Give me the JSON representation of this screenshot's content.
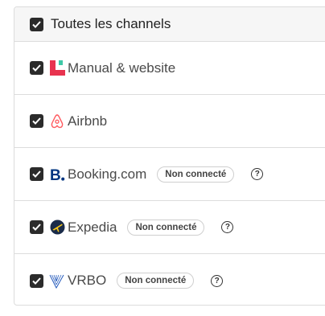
{
  "header": {
    "label": "Toutes les channels",
    "checked": true
  },
  "channels": [
    {
      "name": "Manual & website",
      "logo": "manual-website-logo-icon",
      "checked": true
    },
    {
      "name": "Airbnb",
      "logo": "airbnb-logo-icon",
      "checked": true
    },
    {
      "name": "Booking.com",
      "logo": "booking-logo-icon",
      "checked": true,
      "status": "Non connecté",
      "help": "?"
    },
    {
      "name": "Expedia",
      "logo": "expedia-logo-icon",
      "checked": true,
      "status": "Non connecté",
      "help": "?"
    },
    {
      "name": "VRBO",
      "logo": "vrbo-logo-icon",
      "checked": true,
      "status": "Non connecté",
      "help": "?"
    }
  ],
  "colors": {
    "checkbox": "#2b2b2b",
    "manual_logo": "#e8334f",
    "manual_logo_accent": "#3ec9a7",
    "airbnb": "#ff5a5f",
    "booking": "#003580",
    "expedia_bg": "#1a2b49",
    "expedia_plane": "#f5c518",
    "vrbo": "#245abc"
  }
}
